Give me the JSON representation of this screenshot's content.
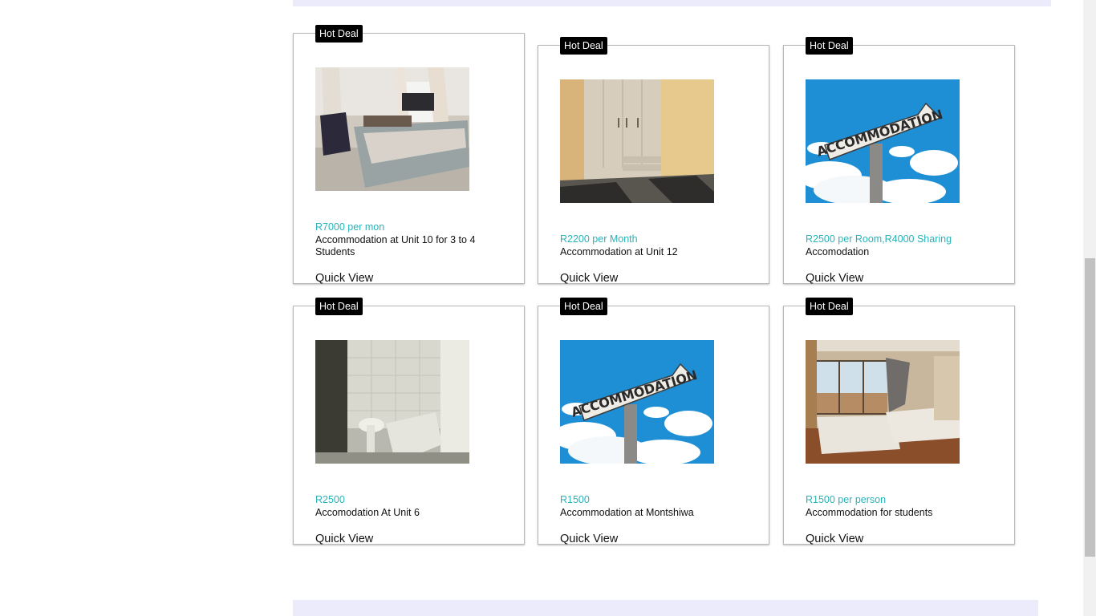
{
  "listings": [
    {
      "badge": "Hot Deal",
      "image": "bedroom-photo",
      "price": "R7000 per mon",
      "title": "Accommodation at Unit 10 for 3 to 4 Students",
      "quick_view": "Quick View"
    },
    {
      "badge": "Hot Deal",
      "image": "wardrobe-room-photo",
      "price": "R2200 per Month",
      "title": "Accommodation at Unit 12",
      "quick_view": "Quick View"
    },
    {
      "badge": "Hot Deal",
      "image": "accommodation-sign-photo",
      "price": "R2500 per Room,R4000 Sharing",
      "title": "Accomodation",
      "quick_view": "Quick View"
    },
    {
      "badge": "Hot Deal",
      "image": "bathroom-photo",
      "price": "R2500",
      "title": "Accomodation At Unit 6",
      "quick_view": "Quick View"
    },
    {
      "badge": "Hot Deal",
      "image": "accommodation-sign-photo",
      "price": "R1500",
      "title": "Accommodation at Montshiwa",
      "quick_view": "Quick View"
    },
    {
      "badge": "Hot Deal",
      "image": "twin-bedroom-photo",
      "price": "R1500 per person",
      "title": "Accommodation for students",
      "quick_view": "Quick View"
    }
  ],
  "sign_text": "ACCOMMODATION",
  "colors": {
    "price": "#28b3b8",
    "badge_bg": "#000000",
    "band": "#ecebfb"
  }
}
